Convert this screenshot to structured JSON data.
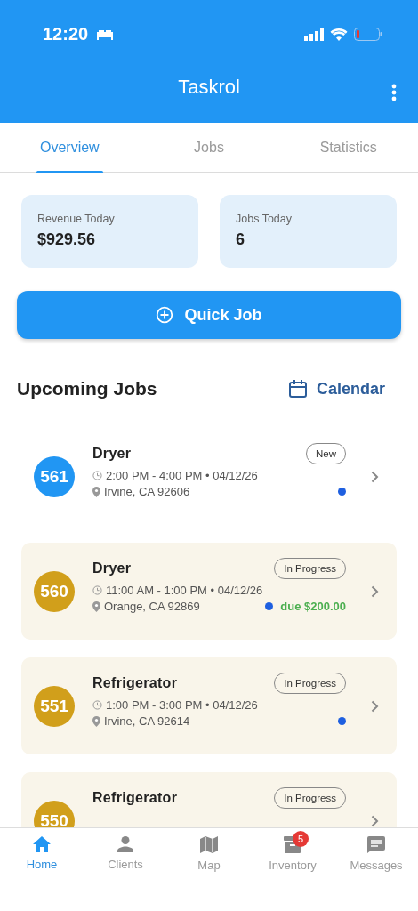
{
  "status_bar": {
    "time": "12:20"
  },
  "app_bar": {
    "title": "Taskrol"
  },
  "tabs": [
    {
      "label": "Overview",
      "selected": true
    },
    {
      "label": "Jobs",
      "selected": false
    },
    {
      "label": "Statistics",
      "selected": false
    }
  ],
  "stats": [
    {
      "label": "Revenue Today",
      "value": "$929.56"
    },
    {
      "label": "Jobs Today",
      "value": "6"
    }
  ],
  "quick_job_button": {
    "label": "Quick Job"
  },
  "upcoming": {
    "title": "Upcoming Jobs",
    "calendar_button": "Calendar"
  },
  "jobs": [
    {
      "number": "561",
      "color": "#2196f3",
      "kind": "new",
      "title": "Dryer",
      "status": "New",
      "time": "2:00 PM - 4:00 PM • 04/12/26",
      "location": "Irvine, CA 92606",
      "dot": true
    },
    {
      "number": "560",
      "color": "#d19f1b",
      "kind": "in_progress",
      "title": "Dryer",
      "status": "In Progress",
      "time": "11:00 AM - 1:00 PM • 04/12/26",
      "location": "Orange, CA 92869",
      "dot": true,
      "due": "due $200.00"
    },
    {
      "number": "551",
      "color": "#d19f1b",
      "kind": "in_progress",
      "title": "Refrigerator",
      "status": "In Progress",
      "time": "1:00 PM - 3:00 PM • 04/12/26",
      "location": "Irvine, CA 92614",
      "dot": true
    },
    {
      "number": "550",
      "color": "#d19f1b",
      "kind": "in_progress",
      "title": "Refrigerator",
      "status": "In Progress"
    }
  ],
  "bottom_nav": [
    {
      "label": "Home",
      "kind": "home",
      "selected": true
    },
    {
      "label": "Clients",
      "kind": "clients",
      "selected": false
    },
    {
      "label": "Map",
      "kind": "map",
      "selected": false
    },
    {
      "label": "Inventory",
      "kind": "inventory",
      "selected": false,
      "badge": "5"
    },
    {
      "label": "Messages",
      "kind": "messages",
      "selected": false
    }
  ]
}
